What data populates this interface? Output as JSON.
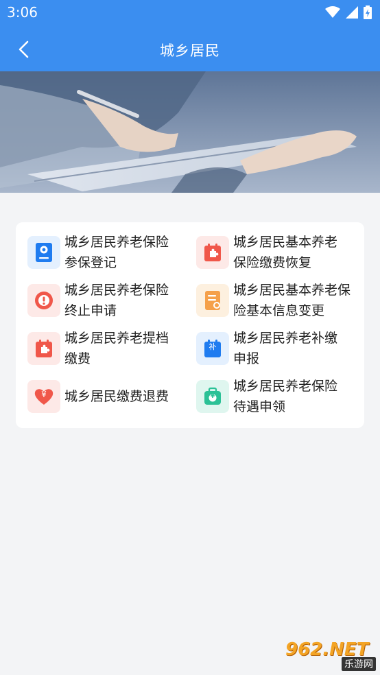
{
  "status_bar": {
    "time": "3:06"
  },
  "header": {
    "title": "城乡居民",
    "back_icon": "chevron-left-icon"
  },
  "banner": {
    "description_icon": "hands-writing-on-clipboard-photo"
  },
  "services": [
    {
      "label": "城乡居民养老保险参保登记",
      "icon": "id-book-icon",
      "color": "#1f7cf0",
      "bg": "#e4f0fe"
    },
    {
      "label": "城乡居民基本养老保险缴费恢复",
      "icon": "puzzle-calendar-icon",
      "color": "#f0574a",
      "bg": "#fde9e7"
    },
    {
      "label": "城乡居民养老保险终止申请",
      "icon": "alert-circle-icon",
      "color": "#f0574a",
      "bg": "#fde9e7"
    },
    {
      "label": "城乡居民基本养老保险基本信息变更",
      "icon": "document-edit-icon",
      "color": "#f5a04a",
      "bg": "#fdf0df"
    },
    {
      "label": "城乡居民养老提档缴费",
      "icon": "puzzle-calendar-icon",
      "color": "#f0574a",
      "bg": "#fde9e7"
    },
    {
      "label": "城乡居民养老补缴申报",
      "icon": "supplement-calendar-icon",
      "color": "#1f7cf0",
      "bg": "#e4f0fe",
      "glyph": "补"
    },
    {
      "label": "城乡居民缴费退费",
      "icon": "heart-yuan-icon",
      "color": "#f0574a",
      "bg": "#fde9e7",
      "glyph": "¥"
    },
    {
      "label": "城乡居民养老保险待遇申领",
      "icon": "wallet-yuan-icon",
      "color": "#2bc196",
      "bg": "#dff6ef",
      "glyph": "¥"
    }
  ],
  "watermark": {
    "brand": "962.NET",
    "sub": "乐游网"
  }
}
